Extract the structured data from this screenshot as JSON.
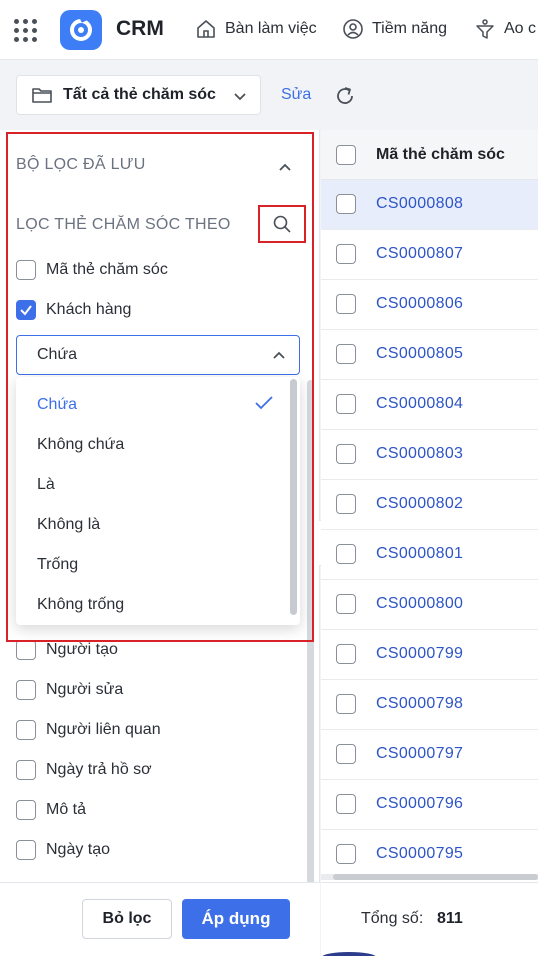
{
  "topbar": {
    "app_name": "CRM",
    "nav": [
      {
        "label": "Bàn làm việc",
        "icon": "home-icon"
      },
      {
        "label": "Tiềm năng",
        "icon": "lead-icon"
      },
      {
        "label": "Ao c",
        "icon": "funnel-icon"
      }
    ]
  },
  "toolbar": {
    "view_label": "Tất cả thẻ chăm sóc",
    "edit_label": "Sửa"
  },
  "filter": {
    "saved_title": "BỘ LỌC ĐÃ LƯU",
    "filter_by_title": "LỌC THẺ CHĂM SÓC THEO",
    "fields_top": [
      {
        "label": "Mã thẻ chăm sóc",
        "checked": false
      },
      {
        "label": "Khách hàng",
        "checked": true
      }
    ],
    "operator_value": "Chứa",
    "operator_options": [
      {
        "label": "Chứa",
        "selected": true
      },
      {
        "label": "Không chứa",
        "selected": false
      },
      {
        "label": "Là",
        "selected": false
      },
      {
        "label": "Không là",
        "selected": false
      },
      {
        "label": "Trống",
        "selected": false
      },
      {
        "label": "Không trống",
        "selected": false
      }
    ],
    "fields_bottom": [
      {
        "label": "Người tạo",
        "checked": false
      },
      {
        "label": "Người sửa",
        "checked": false
      },
      {
        "label": "Người liên quan",
        "checked": false
      },
      {
        "label": "Ngày trả hồ sơ",
        "checked": false
      },
      {
        "label": "Mô tả",
        "checked": false
      },
      {
        "label": "Ngày tạo",
        "checked": false
      }
    ],
    "clear_label": "Bỏ lọc",
    "apply_label": "Áp dụng"
  },
  "table": {
    "column_header": "Mã thẻ chăm sóc",
    "rows": [
      "CS0000808",
      "CS0000807",
      "CS0000806",
      "CS0000805",
      "CS0000804",
      "CS0000803",
      "CS0000802",
      "CS0000801",
      "CS0000800",
      "CS0000799",
      "CS0000798",
      "CS0000797",
      "CS0000796",
      "CS0000795"
    ],
    "active_row_index": 0,
    "total_label": "Tổng số:",
    "total_value": "811"
  },
  "colors": {
    "accent": "#3d6fe8",
    "highlight": "#d92128",
    "link": "#2e55c6"
  }
}
